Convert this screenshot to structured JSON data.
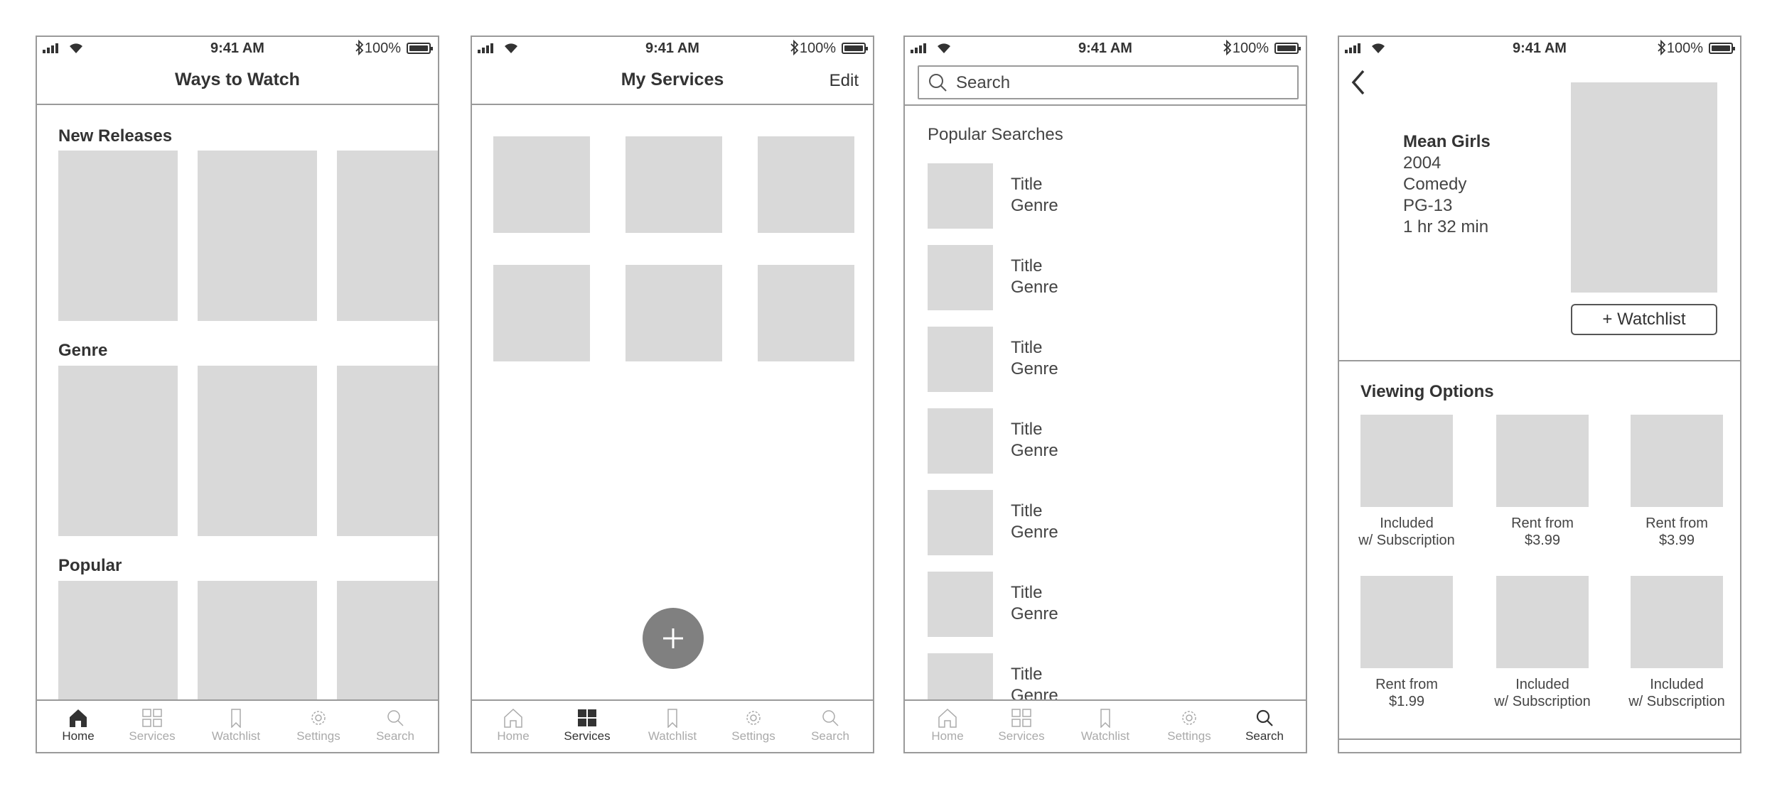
{
  "status_bar": {
    "time": "9:41 AM",
    "battery": "100%"
  },
  "tabs": [
    "Home",
    "Services",
    "Watchlist",
    "Settings",
    "Search"
  ],
  "screen1": {
    "title": "Ways to Watch",
    "sections": [
      "New Releases",
      "Genre",
      "Popular"
    ],
    "active_tab": "Home"
  },
  "screen2": {
    "title": "My Services",
    "edit_label": "Edit",
    "fab_symbol": "+",
    "active_tab": "Services"
  },
  "screen3": {
    "search_placeholder": "Search",
    "section": "Popular Searches",
    "results": [
      {
        "title": "Title",
        "genre": "Genre"
      },
      {
        "title": "Title",
        "genre": "Genre"
      },
      {
        "title": "Title",
        "genre": "Genre"
      },
      {
        "title": "Title",
        "genre": "Genre"
      },
      {
        "title": "Title",
        "genre": "Genre"
      },
      {
        "title": "Title",
        "genre": "Genre"
      },
      {
        "title": "Title",
        "genre": "Genre"
      }
    ],
    "active_tab": "Search"
  },
  "screen4": {
    "movie": {
      "title": "Mean Girls",
      "year": "2004",
      "genre": "Comedy",
      "rating": "PG-13",
      "runtime": "1 hr 32 min"
    },
    "watchlist_button": "+ Watchlist",
    "section": "Viewing Options",
    "options": [
      {
        "line1": "Included",
        "line2": "w/ Subscription"
      },
      {
        "line1": "Rent from",
        "line2": "$3.99"
      },
      {
        "line1": "Rent from",
        "line2": "$3.99"
      },
      {
        "line1": "Rent from",
        "line2": "$1.99"
      },
      {
        "line1": "Included",
        "line2": "w/ Subscription"
      },
      {
        "line1": "Included",
        "line2": "w/ Subscription"
      }
    ]
  },
  "colors": {
    "placeholder": "#d9d9d9",
    "border": "#9a9a9a",
    "fab": "#808080",
    "inactive_tab": "#aaaaaa"
  }
}
